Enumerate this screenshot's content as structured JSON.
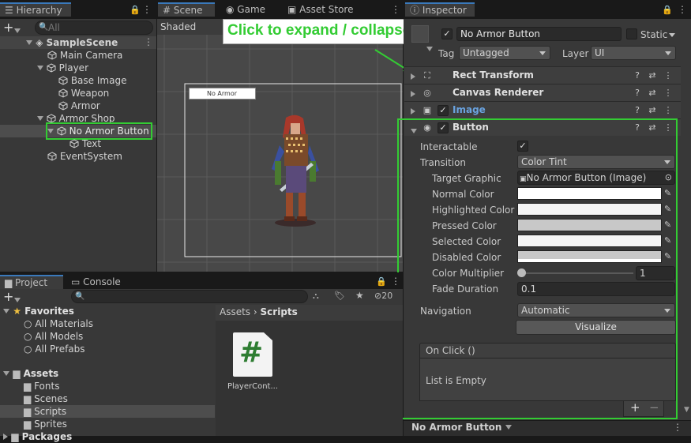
{
  "hierarchy": {
    "tab": "Hierarchy",
    "search_placeholder": "All",
    "items": [
      {
        "label": "SampleScene"
      },
      {
        "label": "Main Camera"
      },
      {
        "label": "Player"
      },
      {
        "label": "Base Image"
      },
      {
        "label": "Weapon"
      },
      {
        "label": "Armor"
      },
      {
        "label": "Armor Shop"
      },
      {
        "label": "No Armor Button"
      },
      {
        "label": "Text"
      },
      {
        "label": "EventSystem"
      }
    ]
  },
  "scene": {
    "tabs": [
      "Scene",
      "Game",
      "Asset Store"
    ],
    "shading": "Shaded",
    "button_text": "No Armor"
  },
  "inspector": {
    "tab": "Inspector",
    "object_name": "No Armor Button",
    "static_label": "Static",
    "tag_label": "Tag",
    "tag_value": "Untagged",
    "layer_label": "Layer",
    "layer_value": "UI",
    "components": [
      "Rect Transform",
      "Canvas Renderer",
      "Image",
      "Button"
    ],
    "button": {
      "interactable": "Interactable",
      "transition": "Transition",
      "transition_value": "Color Tint",
      "target_graphic": "Target Graphic",
      "target_graphic_value": "No Armor Button (Image)",
      "normal": "Normal Color",
      "highlighted": "Highlighted Color",
      "pressed": "Pressed Color",
      "selected": "Selected Color",
      "disabled": "Disabled Color",
      "multiplier": "Color Multiplier",
      "multiplier_value": "1",
      "fade": "Fade Duration",
      "fade_value": "0.1",
      "navigation": "Navigation",
      "navigation_value": "Automatic",
      "visualize": "Visualize",
      "onclick": "On Click ()",
      "list_empty": "List is Empty"
    }
  },
  "annotation": {
    "text": "Click to expand / collapse",
    "color": "#33cc33"
  },
  "project": {
    "tabs": [
      "Project",
      "Console"
    ],
    "count": "20",
    "favorites_label": "Favorites",
    "favorites": [
      "All Materials",
      "All Models",
      "All Prefabs"
    ],
    "assets_label": "Assets",
    "folders": [
      "Fonts",
      "Scenes",
      "Scripts",
      "Sprites"
    ],
    "packages_label": "Packages",
    "breadcrumb_root": "Assets",
    "breadcrumb_current": "Scripts",
    "file_label": "PlayerCont...",
    "file_icon": "#"
  },
  "bottombar": {
    "label": "No Armor Button"
  }
}
